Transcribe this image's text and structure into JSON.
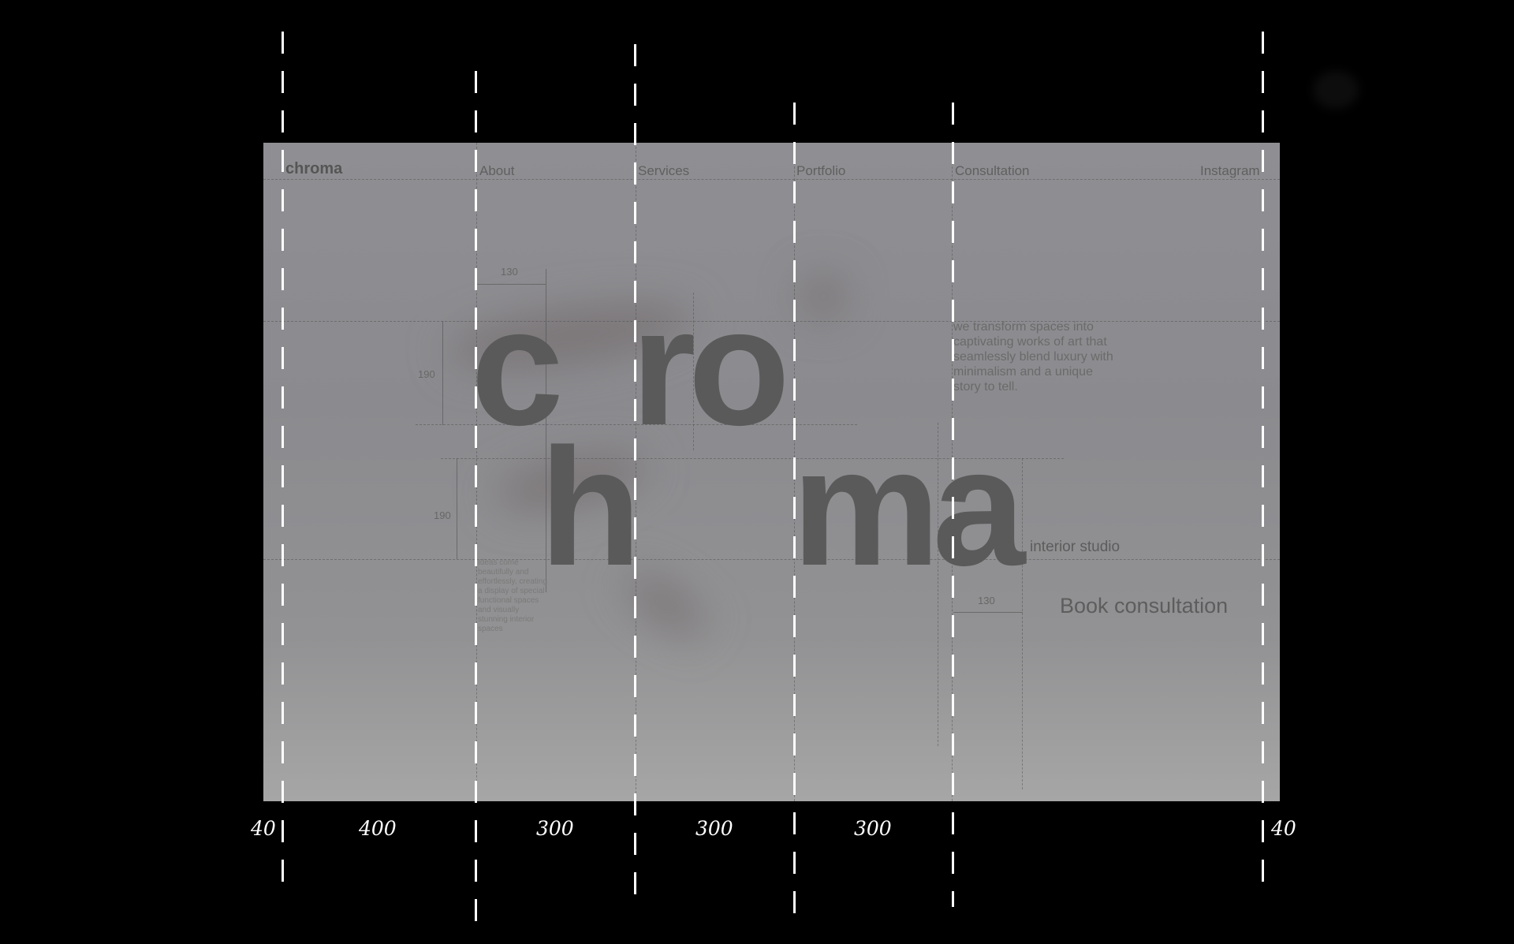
{
  "nav": {
    "brand": "chroma",
    "items": [
      "About",
      "Services",
      "Portfolio",
      "Consultation",
      "Instagram"
    ]
  },
  "hero": {
    "letters": [
      "c",
      "ro",
      "h",
      "ma"
    ],
    "tagline": "we transform spaces into captivating works of art that seamlessly blend luxury with minimalism and a unique story to tell.",
    "subtitle": "interior studio",
    "cta": "Book consultation",
    "small_text": "Ideas come beautifully and effortlessly, creating a display of special functional spaces and visually stunning interior spaces"
  },
  "dimensions": {
    "top_width": "130",
    "row_height_1": "190",
    "row_height_2": "190",
    "bottom_width": "130"
  },
  "columns": {
    "labels": [
      "40",
      "400",
      "300",
      "300",
      "300",
      "40"
    ]
  },
  "colors": {
    "background": "#000000",
    "guide": "#ffffff",
    "card": "#8f8f93",
    "letters": "#5a5a5a"
  }
}
